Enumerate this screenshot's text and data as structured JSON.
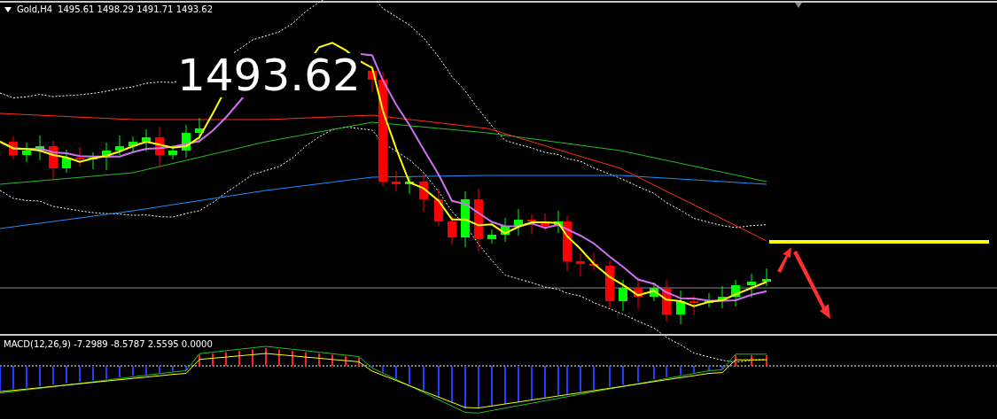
{
  "chart": {
    "symbol": "Gold,H4",
    "ohlc": "1495.61 1498.29 1491.71 1493.62",
    "price_overlay": "1493.62"
  },
  "indicator": {
    "label": "MACD(12,26,9) -7.2989 -8.5787 2.5595 0.0000"
  }
}
